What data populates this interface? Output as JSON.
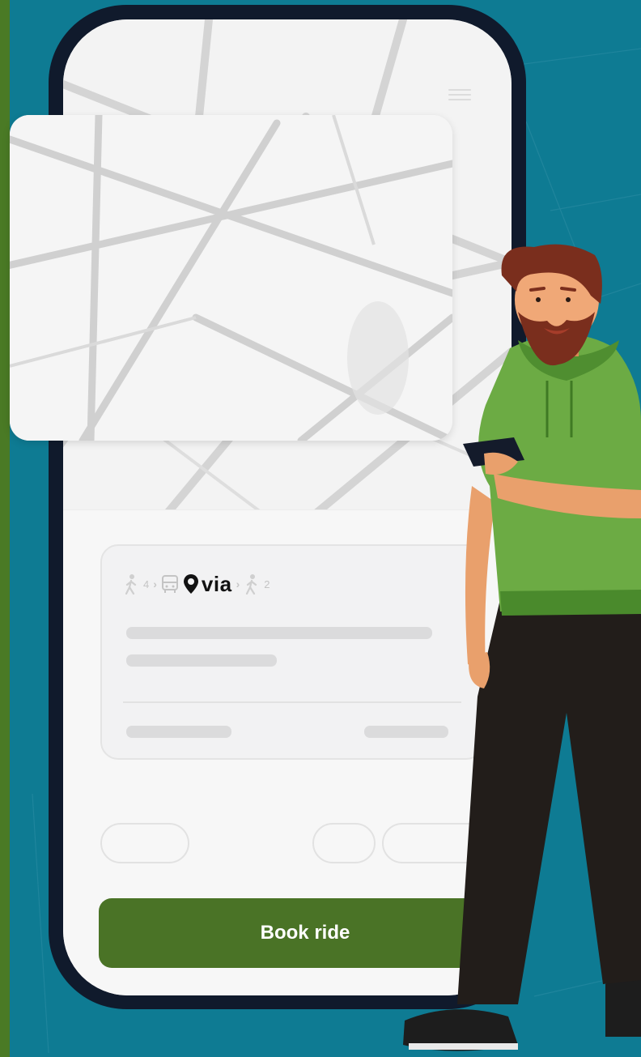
{
  "route": {
    "steps": [
      {
        "icon": "walk-icon",
        "value": "4"
      },
      {
        "icon": "bus-icon",
        "value": ""
      },
      {
        "icon": "via-logo",
        "value": "via"
      },
      {
        "icon": "walk-icon",
        "value": "2"
      }
    ]
  },
  "actions": {
    "book_label": "Book ride"
  },
  "colors": {
    "background": "#0e7b93",
    "accent_bar": "#4a7a25",
    "button": "#4a7326",
    "phone_frame": "#101a2c"
  },
  "icons": [
    "menu-icon",
    "walk-icon",
    "bus-icon",
    "via-pin-icon",
    "chevron-right-icon"
  ]
}
